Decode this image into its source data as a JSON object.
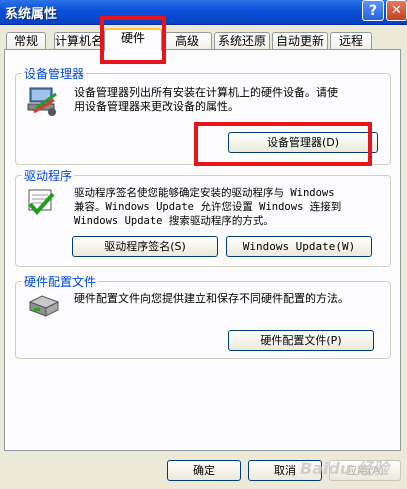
{
  "window": {
    "title": "系统属性",
    "help": "?",
    "close": "✕"
  },
  "tabs": [
    {
      "label": "常规"
    },
    {
      "label": "计算机名"
    },
    {
      "label": "硬件"
    },
    {
      "label": "高级"
    },
    {
      "label": "系统还原"
    },
    {
      "label": "自动更新"
    },
    {
      "label": "远程"
    }
  ],
  "device_manager": {
    "title": "设备管理器",
    "description_line1": "设备管理器列出所有安装在计算机上的硬件设备。请使",
    "description_line2": "用设备管理器来更改设备的属性。",
    "button": "设备管理器(D)"
  },
  "drivers": {
    "title": "驱动程序",
    "description_line1": "驱动程序签名使您能够确定安装的驱动程序与 Windows",
    "description_line2": "兼容。Windows Update 允许您设置 Windows 连接到",
    "description_line3": "Windows Update 搜索驱动程序的方式。",
    "signing_button": "驱动程序签名(S)",
    "update_button": "Windows Update(W)"
  },
  "hardware_profiles": {
    "title": "硬件配置文件",
    "description": "硬件配置文件向您提供建立和保存不同硬件配置的方法。",
    "button": "硬件配置文件(P)"
  },
  "footer": {
    "ok": "确定",
    "cancel": "取消",
    "apply": "应用(A)"
  },
  "watermark": "Baidu 经验",
  "colors": {
    "highlight": "#e8141c",
    "titlebar": "#0a4fd8",
    "group_title": "#0046d5"
  }
}
